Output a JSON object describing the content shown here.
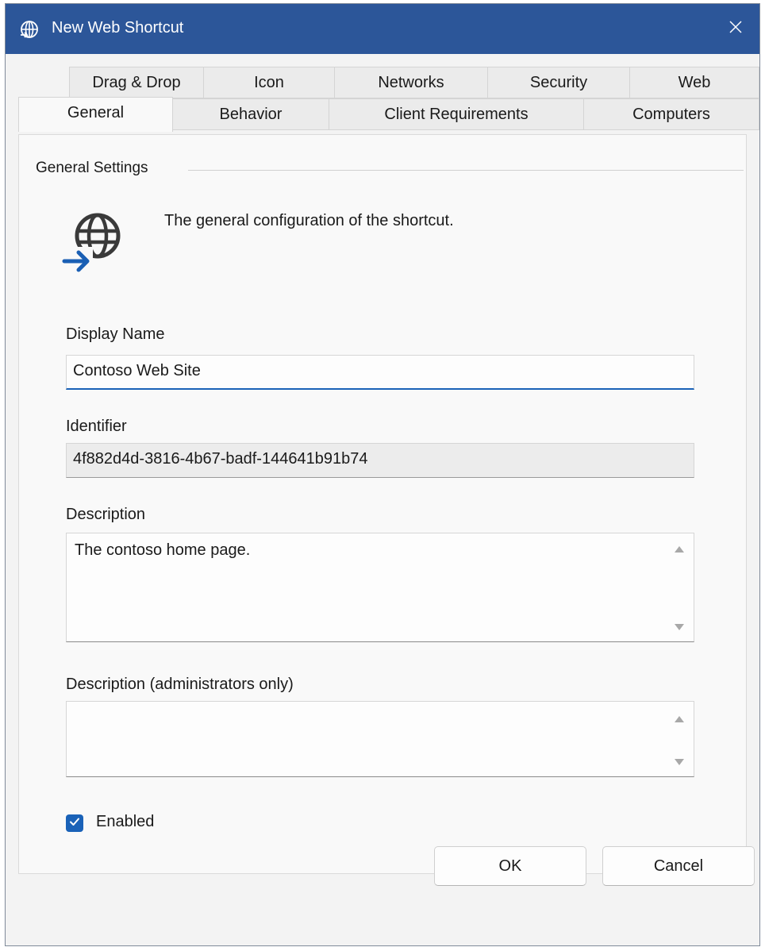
{
  "window": {
    "title": "New Web Shortcut"
  },
  "tabs_back": [
    "Drag & Drop",
    "Icon",
    "Networks",
    "Security",
    "Web"
  ],
  "tabs_front": [
    "General",
    "Behavior",
    "Client Requirements",
    "Computers"
  ],
  "active_tab": "General",
  "group": {
    "title": "General Settings",
    "intro": "The general configuration of the shortcut."
  },
  "fields": {
    "display_name_label": "Display Name",
    "display_name_value": "Contoso Web Site",
    "identifier_label": "Identifier",
    "identifier_value": "4f882d4d-3816-4b67-badf-144641b91b74",
    "description_label": "Description",
    "description_value": "The contoso home page.",
    "admin_description_label": "Description (administrators only)",
    "admin_description_value": ""
  },
  "enabled": {
    "label": "Enabled",
    "checked": true
  },
  "buttons": {
    "ok": "OK",
    "cancel": "Cancel"
  },
  "colors": {
    "titlebar": "#2c5699",
    "accent": "#1a62b8"
  },
  "icons": {
    "title": "globe-arrow-icon",
    "close": "close-icon",
    "main": "globe-arrow-icon",
    "check": "checkmark-icon"
  }
}
